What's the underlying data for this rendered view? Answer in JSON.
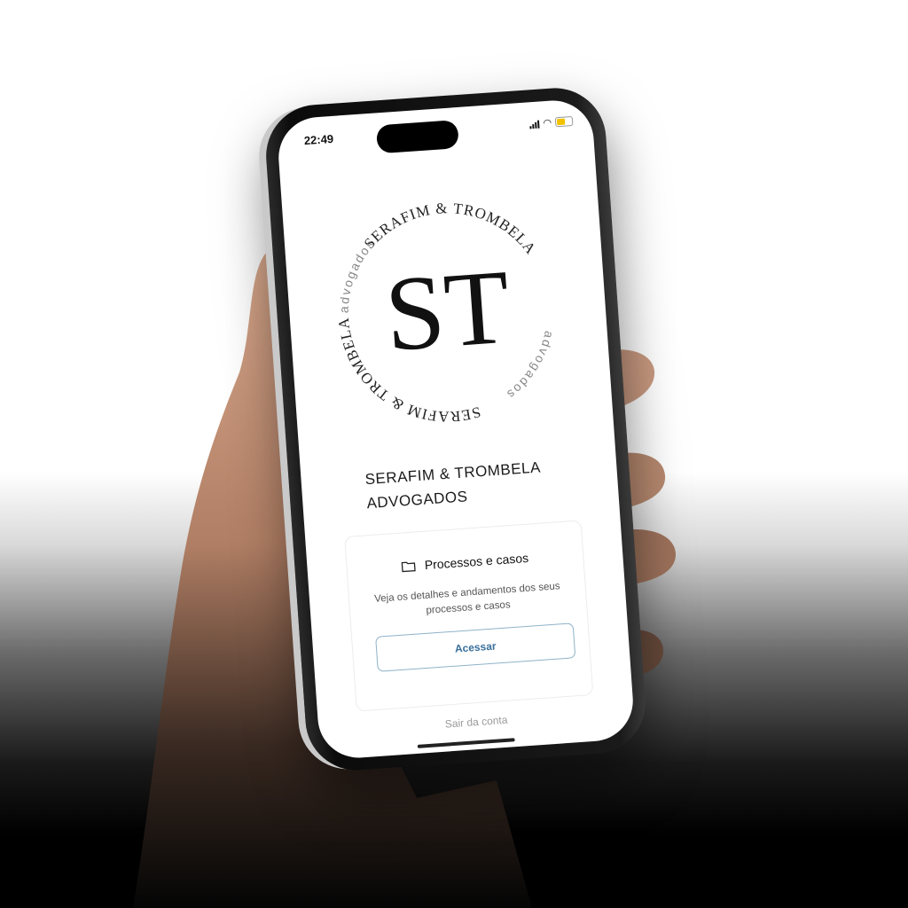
{
  "status_bar": {
    "time": "22:49"
  },
  "logo": {
    "monogram": "ST",
    "ring_top": "SERAFIM & TROMBELA",
    "ring_sub": "advogados"
  },
  "firm": {
    "name_line1": "SERAFIM & TROMBELA",
    "name_line2": "ADVOGADOS"
  },
  "card": {
    "icon": "folder-icon",
    "title": "Processos e casos",
    "description": "Veja os detalhes e andamentos dos seus processos e casos",
    "button_label": "Acessar"
  },
  "footer": {
    "logout_label": "Sair da conta"
  },
  "colors": {
    "accent": "#3a6f9a",
    "button_border": "#8fb2c9",
    "battery": "#f2c200"
  }
}
